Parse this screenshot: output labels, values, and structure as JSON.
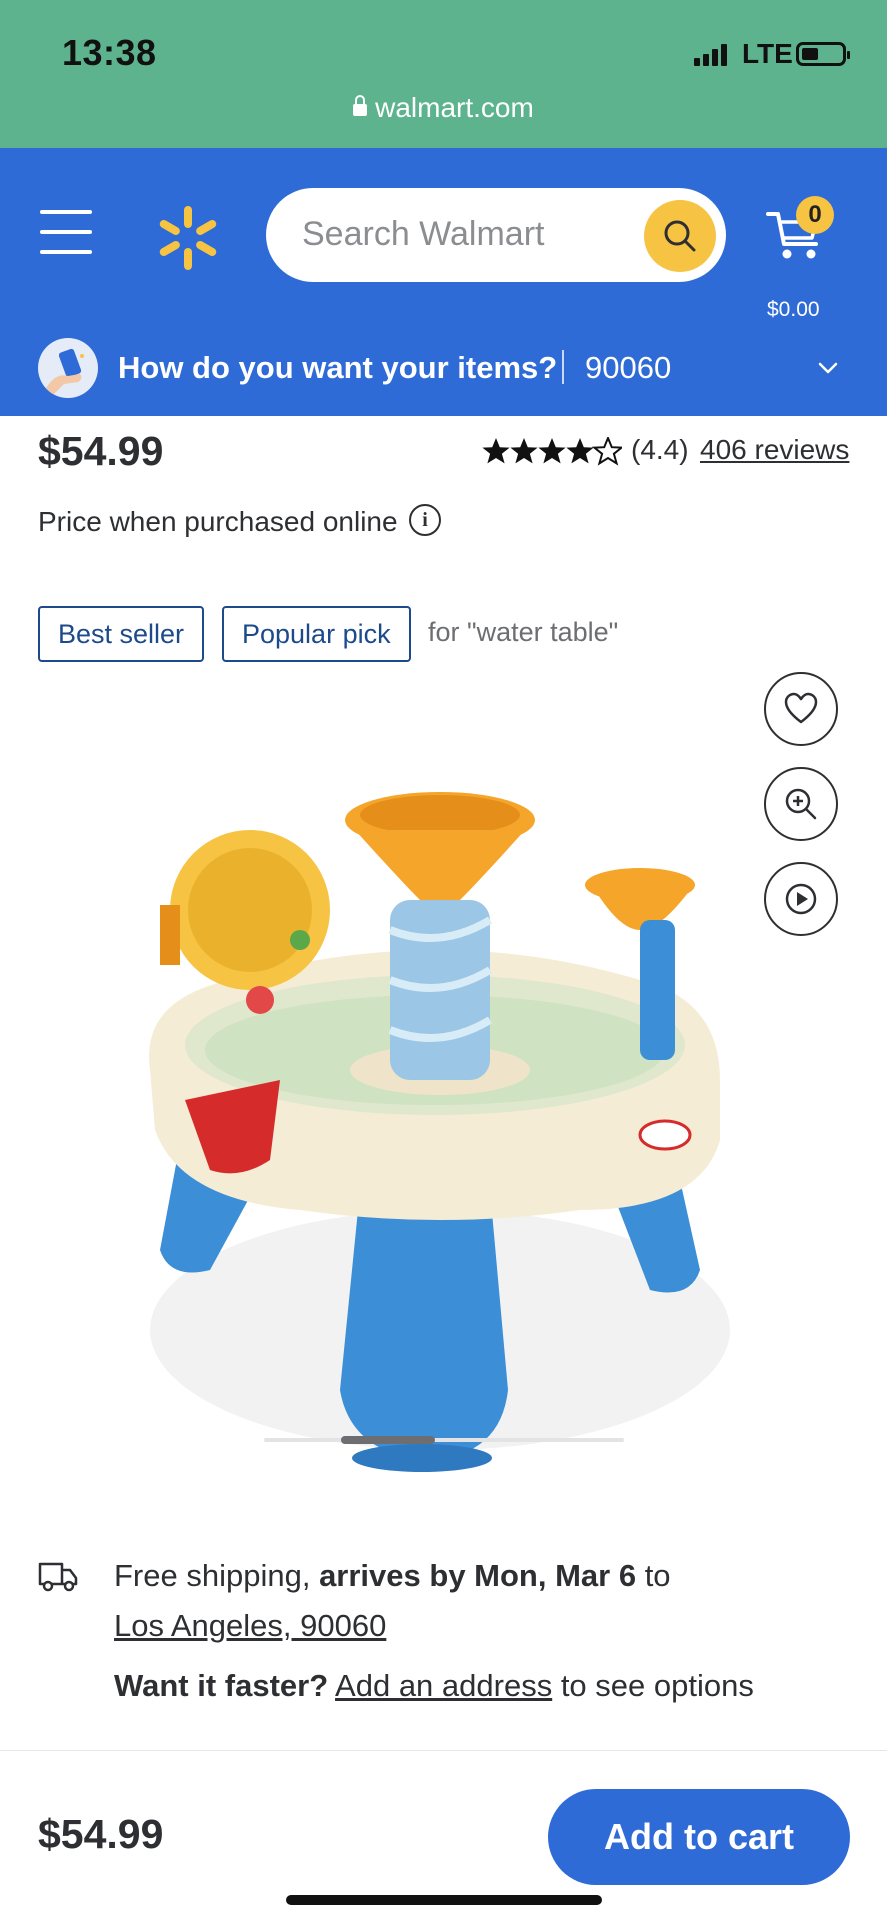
{
  "status_bar": {
    "time": "13:38",
    "network": "LTE",
    "url": "walmart.com"
  },
  "header": {
    "search_placeholder": "Search Walmart",
    "cart_count": "0",
    "cart_total": "$0.00",
    "delivery_prompt": "How do you want your items?",
    "zip": "90060",
    "brand_color": "#2f6bd6",
    "accent_color": "#f6c343"
  },
  "product": {
    "price": "$54.99",
    "rating_value": 4.4,
    "rating_text": "(4.4)",
    "reviews": "406 reviews",
    "price_note": "Price when purchased online",
    "badges": [
      "Best seller",
      "Popular pick"
    ],
    "badge_context": "for \"water table\"",
    "image_icons": [
      "heart-icon",
      "zoom-in-icon",
      "play-icon"
    ]
  },
  "shipping": {
    "prefix": "Free shipping, ",
    "arrives": "arrives by Mon, Mar 6",
    "to": " to",
    "location": "Los Angeles, 90060",
    "faster_label": "Want it faster?",
    "add_address": "Add an address",
    "faster_suffix": " to see options"
  },
  "bottom": {
    "price": "$54.99",
    "add_to_cart": "Add to cart"
  }
}
